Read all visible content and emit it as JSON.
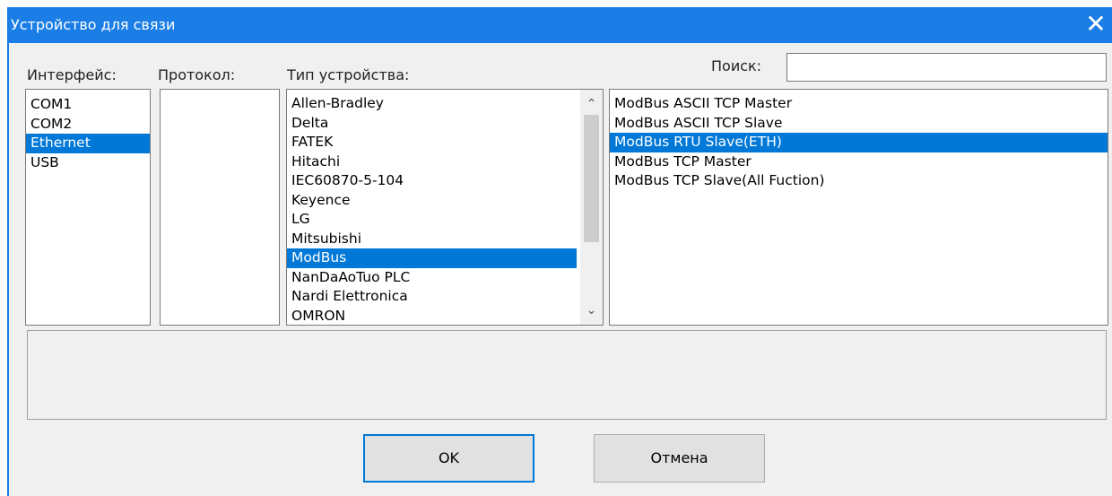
{
  "window": {
    "title": "Устройство для связи",
    "close_glyph": "✕"
  },
  "labels": {
    "interface": "Интерфейс:",
    "protocol": "Протокол:",
    "device_type": "Тип устройства:",
    "search": "Поиск:"
  },
  "search": {
    "value": ""
  },
  "interface_list": [
    "COM1",
    "COM2",
    "Ethernet",
    "USB"
  ],
  "interface_selected": 2,
  "protocol_list": [],
  "device_list": [
    "Allen-Bradley",
    "Delta",
    "FATEK",
    "Hitachi",
    "IEC60870-5-104",
    "Keyence",
    "LG",
    "Mitsubishi",
    "ModBus",
    "NanDaAoTuo PLC",
    "Nardi Elettronica",
    "OMRON"
  ],
  "device_selected": 8,
  "driver_list": [
    "ModBus ASCII TCP Master",
    "ModBus ASCII TCP Slave",
    "ModBus RTU Slave(ETH)",
    "ModBus TCP Master",
    "ModBus TCP Slave(All Fuction)"
  ],
  "driver_selected": 2,
  "scroll": {
    "up_glyph": "⌃",
    "down_glyph": "⌄"
  },
  "buttons": {
    "ok": "OK",
    "cancel": "Отмена"
  },
  "colors": {
    "titlebar": "#1a7ee6",
    "selection": "#0078d7",
    "default_button_border": "#0078d7"
  }
}
